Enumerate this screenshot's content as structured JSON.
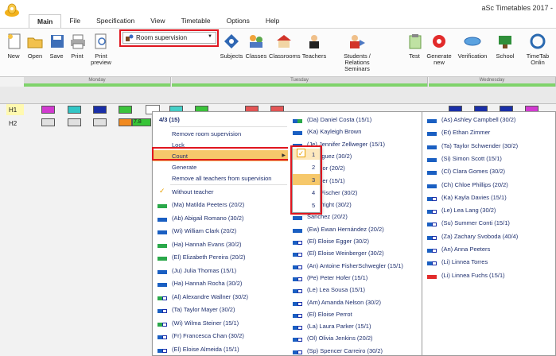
{
  "app": {
    "title": "aSc Timetables 2017 -"
  },
  "menu_tabs": [
    "Main",
    "File",
    "Specification",
    "View",
    "Timetable",
    "Options",
    "Help"
  ],
  "ribbon": {
    "new": "New",
    "open": "Open",
    "save": "Save",
    "print": "Print",
    "print_preview": "Print preview",
    "room_supervision": "Room supervision",
    "subjects": "Subjects",
    "classes": "Classes",
    "classrooms": "Classrooms",
    "teachers": "Teachers",
    "students": "Students / Relations Seminars",
    "test": "Test",
    "generate_new": "Generate new",
    "verification": "Verification",
    "school": "School",
    "timetable_online": "TimeTab Onlin"
  },
  "grid": {
    "days": [
      "Monday",
      "Tuesday",
      "Wednesday"
    ],
    "rows": [
      "H1",
      "H2"
    ],
    "cell_text": "7.8"
  },
  "context_menu": {
    "header": "4/3 (15)",
    "items": [
      "Remove room supervision",
      "Lock",
      "Count",
      "Generate",
      "Remove all teachers from supervision"
    ],
    "without_teacher": "Without teacher",
    "teachers": [
      "(Ma) Matilda Peeters (20/2)",
      "(Ab) Abigail Romano (30/2)",
      "(Wi) William Clark (20/2)",
      "(Ha) Hannah Evans (30/2)",
      "(El) Elizabeth Pereira (20/2)",
      "(Ju) Julia Thomas (15/1)",
      "(Ha) Hannah Rocha (30/2)",
      "(Al) Alexandre Wallner (30/2)",
      "(Ta) Taylor Mayer (30/2)",
      "(Wi) Wilma Steiner (15/1)",
      "(Fr) Francesca Chan (30/2)",
      "(El) Eloise Almeida (15/1)"
    ],
    "col2": [
      "(Da) Daniel Costa (15/1)",
      "(Ka) Kayleigh Brown",
      "(Je) Jennifer Zellweger (15/1)",
      "Rodríguez (30/2)",
      "e Taylor (20/2)",
      "Wagner (15/1)",
      "nder Fischer (30/2)",
      "rav Wright (30/2)",
      "Sanchez (20/2)",
      "(Ew) Ewan Hernández (20/2)",
      "(El) Eloise Egger (30/2)",
      "(El) Eloise Weinberger (30/2)",
      "(An) Antoine FisherSchwegler (15/1)",
      "(Pe) Peter Hofer (15/1)",
      "(Le) Lea Sousa (15/1)",
      "(Am) Amanda Nelson (30/2)",
      "(El) Eloise Perrot",
      "(La) Laura Parker (15/1)",
      "(Ol) Olivia Jenkins (20/2)",
      "(Sp) Spencer Carreiro (30/2)"
    ],
    "col3": [
      "(As) Ashley Campbell (30/2)",
      "(Et) Ethan Zimmer",
      "(Ta) Taylor Schwender (30/2)",
      "(Si) Simon Scott (15/1)",
      "(Cl) Clara Gomes (30/2)",
      "(Ch) Chloe Phillips (20/2)",
      "(Ka) Kayla Davies (15/1)",
      "(Le) Lea Lang (30/2)",
      "(Su) Summer Conti (15/1)",
      "(Za) Zachary Svoboda (40/4)",
      "(An) Anna Peeters",
      "(Li) Linnea Torres",
      "(Li) Linnea Fuchs (15/1)"
    ]
  },
  "count_menu": {
    "options": [
      "1",
      "2",
      "3",
      "4",
      "5"
    ],
    "checked": "1",
    "highlighted": "3"
  },
  "colors": {
    "highlight": "#f6c86b",
    "annotation": "#e0161f",
    "menu_text": "#1e2f6e"
  }
}
